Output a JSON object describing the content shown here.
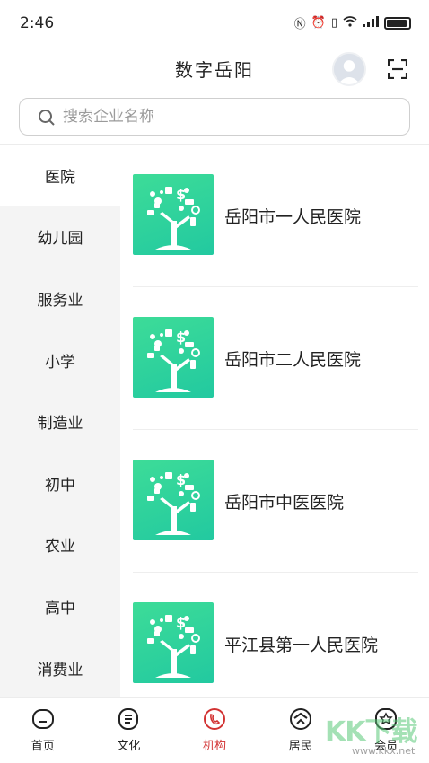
{
  "status_bar": {
    "time": "2:46"
  },
  "header": {
    "title": "数字岳阳"
  },
  "search": {
    "placeholder": "搜索企业名称"
  },
  "sidebar": {
    "items": [
      {
        "label": "医院",
        "active": true
      },
      {
        "label": "幼儿园",
        "active": false
      },
      {
        "label": "服务业",
        "active": false
      },
      {
        "label": "小学",
        "active": false
      },
      {
        "label": "制造业",
        "active": false
      },
      {
        "label": "初中",
        "active": false
      },
      {
        "label": "农业",
        "active": false
      },
      {
        "label": "高中",
        "active": false
      },
      {
        "label": "消费业",
        "active": false
      }
    ]
  },
  "organizations": [
    {
      "name": "岳阳市一人民医院",
      "icon": "money-tree-icon"
    },
    {
      "name": "岳阳市二人民医院",
      "icon": "money-tree-icon"
    },
    {
      "name": "岳阳市中医医院",
      "icon": "money-tree-icon"
    },
    {
      "name": "平江县第一人民医院",
      "icon": "money-tree-icon"
    }
  ],
  "bottom_nav": {
    "items": [
      {
        "label": "首页",
        "icon": "home-icon",
        "active": false
      },
      {
        "label": "文化",
        "icon": "document-icon",
        "active": false
      },
      {
        "label": "机构",
        "icon": "phone-icon",
        "active": true
      },
      {
        "label": "居民",
        "icon": "residents-icon",
        "active": false
      },
      {
        "label": "会员",
        "icon": "member-icon",
        "active": false
      }
    ]
  },
  "watermark": {
    "text": "KK下载",
    "url": "www.kkx.net"
  },
  "colors": {
    "accent": "#d23232",
    "thumb_green": "#2fd3a0",
    "sidebar_bg": "#f4f4f4"
  }
}
